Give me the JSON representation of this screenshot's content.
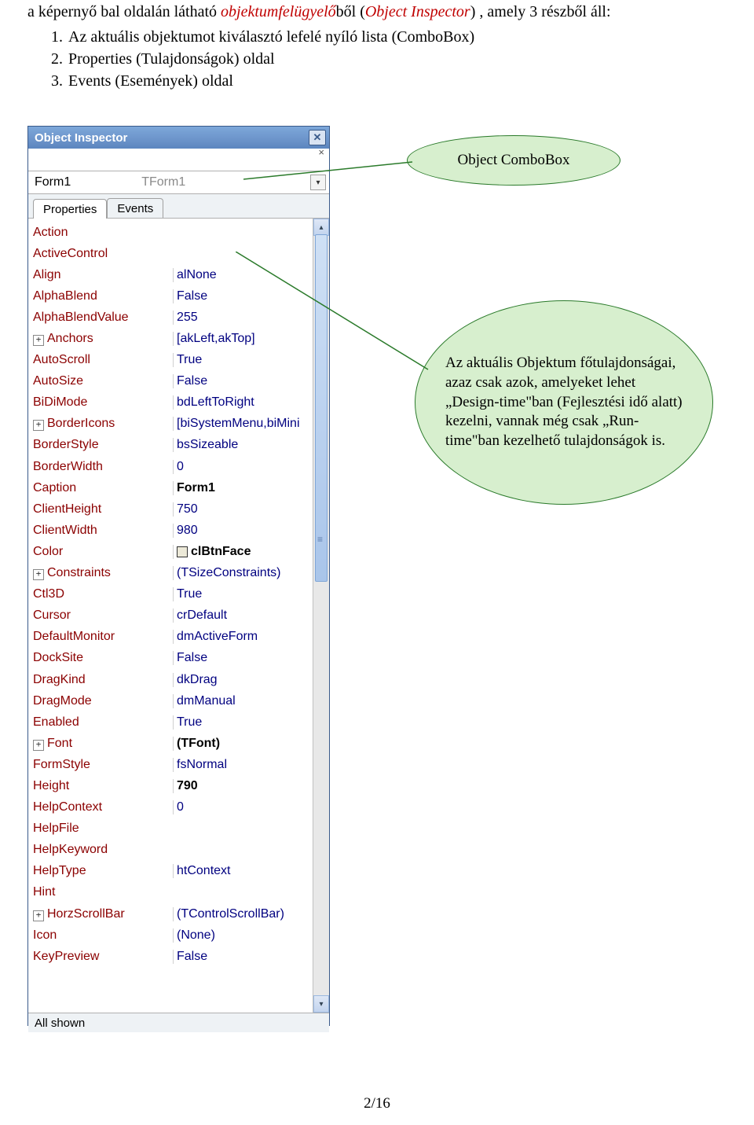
{
  "text": {
    "intro_pre": "a képernyő bal oldalán látható ",
    "intro_term": "objektumfelügyelő",
    "intro_mid": "ből (",
    "intro_term2": "Object Inspector",
    "intro_post": ") , amely 3 részből áll:",
    "items": [
      "Az aktuális objektumot kiválasztó lefelé nyíló lista (ComboBox)",
      "Properties (Tulajdonságok) oldal",
      "Events (Események) oldal"
    ]
  },
  "callout1": "Object ComboBox",
  "callout2": "Az aktuális Objektum főtulajdonságai, azaz csak azok, amelyeket lehet „Design-time\"ban  (Fejlesztési idő alatt) kezelni, vannak még csak „Run-time\"ban kezelhető tulajdonságok is.",
  "inspector": {
    "title": "Object Inspector",
    "combo_obj": "Form1",
    "combo_class": "TForm1",
    "tabs": [
      "Properties",
      "Events"
    ],
    "properties": [
      {
        "name": "Action",
        "value": ""
      },
      {
        "name": "ActiveControl",
        "value": ""
      },
      {
        "name": "Align",
        "value": "alNone"
      },
      {
        "name": "AlphaBlend",
        "value": "False"
      },
      {
        "name": "AlphaBlendValue",
        "value": "255"
      },
      {
        "name": "Anchors",
        "value": "[akLeft,akTop]",
        "expand": true
      },
      {
        "name": "AutoScroll",
        "value": "True"
      },
      {
        "name": "AutoSize",
        "value": "False"
      },
      {
        "name": "BiDiMode",
        "value": "bdLeftToRight"
      },
      {
        "name": "BorderIcons",
        "value": "[biSystemMenu,biMini",
        "expand": true
      },
      {
        "name": "BorderStyle",
        "value": "bsSizeable"
      },
      {
        "name": "BorderWidth",
        "value": "0"
      },
      {
        "name": "Caption",
        "value": "Form1",
        "bold": true
      },
      {
        "name": "ClientHeight",
        "value": "750"
      },
      {
        "name": "ClientWidth",
        "value": "980"
      },
      {
        "name": "Color",
        "value": "clBtnFace",
        "swatch": true,
        "bold": true
      },
      {
        "name": "Constraints",
        "value": "(TSizeConstraints)",
        "expand": true
      },
      {
        "name": "Ctl3D",
        "value": "True"
      },
      {
        "name": "Cursor",
        "value": "crDefault"
      },
      {
        "name": "DefaultMonitor",
        "value": "dmActiveForm"
      },
      {
        "name": "DockSite",
        "value": "False"
      },
      {
        "name": "DragKind",
        "value": "dkDrag"
      },
      {
        "name": "DragMode",
        "value": "dmManual"
      },
      {
        "name": "Enabled",
        "value": "True"
      },
      {
        "name": "Font",
        "value": "(TFont)",
        "expand": true,
        "bold": true
      },
      {
        "name": "FormStyle",
        "value": "fsNormal"
      },
      {
        "name": "Height",
        "value": "790",
        "bold": true
      },
      {
        "name": "HelpContext",
        "value": "0"
      },
      {
        "name": "HelpFile",
        "value": ""
      },
      {
        "name": "HelpKeyword",
        "value": ""
      },
      {
        "name": "HelpType",
        "value": "htContext"
      },
      {
        "name": "Hint",
        "value": ""
      },
      {
        "name": "HorzScrollBar",
        "value": "(TControlScrollBar)",
        "expand": true
      },
      {
        "name": "Icon",
        "value": "(None)"
      },
      {
        "name": "KeyPreview",
        "value": "False"
      }
    ],
    "status": "All shown"
  },
  "page_number": "2/16"
}
